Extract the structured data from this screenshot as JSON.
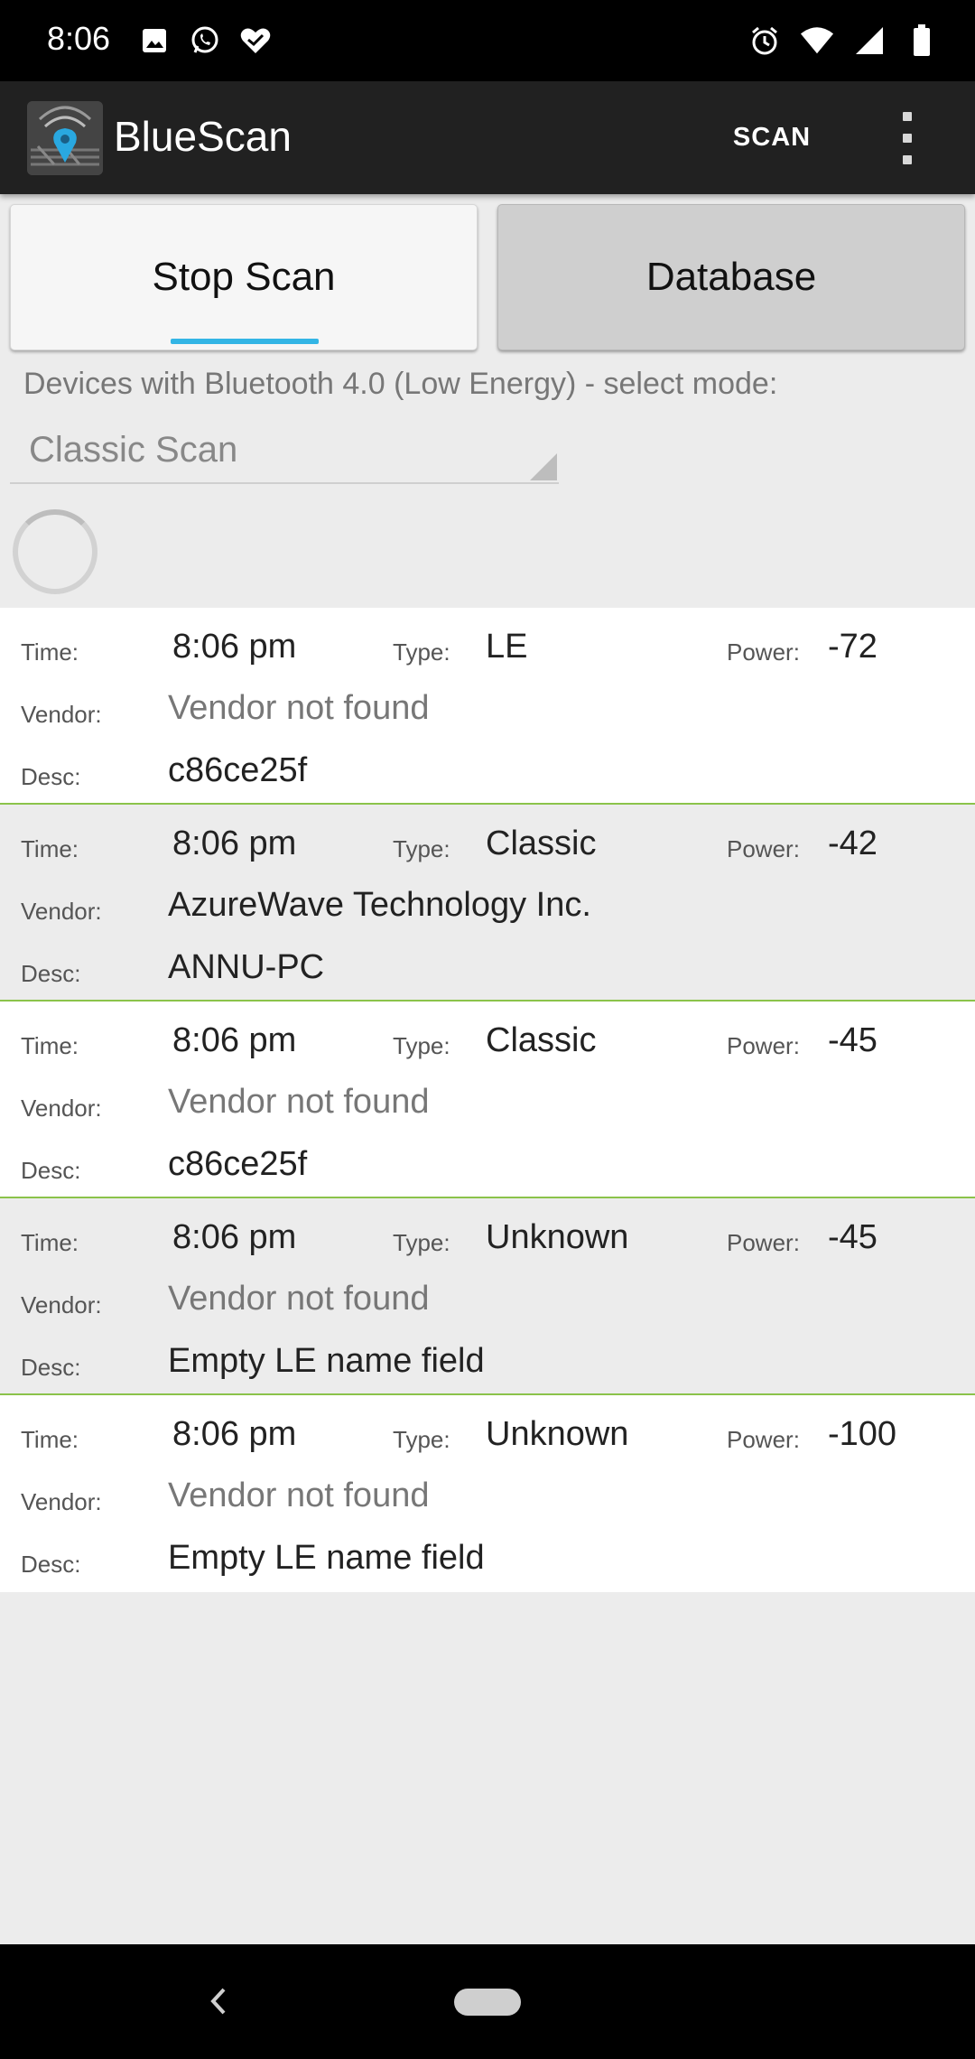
{
  "status_bar": {
    "time": "8:06",
    "left_icons": [
      "image-icon",
      "whatsapp-icon",
      "heart-check-icon"
    ],
    "right_icons": [
      "alarm-icon",
      "wifi-icon",
      "signal-icon",
      "battery-icon"
    ]
  },
  "app_bar": {
    "title": "BlueScan",
    "scan_action": "SCAN"
  },
  "buttons": {
    "stop_scan": "Stop Scan",
    "database": "Database"
  },
  "mode_label": "Devices with Bluetooth 4.0 (Low Energy) - select mode:",
  "mode_select": {
    "value": "Classic Scan"
  },
  "labels": {
    "time": "Time:",
    "type": "Type:",
    "power": "Power:",
    "vendor": "Vendor:",
    "desc": "Desc:"
  },
  "devices": [
    {
      "time": "8:06 pm",
      "type": "LE",
      "power": "-72",
      "vendor": "Vendor not found",
      "desc": "c86ce25f"
    },
    {
      "time": "8:06 pm",
      "type": "Classic",
      "power": "-42",
      "vendor": "AzureWave Technology Inc.",
      "desc": "ANNU-PC"
    },
    {
      "time": "8:06 pm",
      "type": "Classic",
      "power": "-45",
      "vendor": "Vendor not found",
      "desc": "c86ce25f"
    },
    {
      "time": "8:06 pm",
      "type": "Unknown",
      "power": "-45",
      "vendor": "Vendor not found",
      "desc": "Empty LE name field"
    },
    {
      "time": "8:06 pm",
      "type": "Unknown",
      "power": "-100",
      "vendor": "Vendor not found",
      "desc": "Empty LE name field"
    }
  ],
  "colors": {
    "accent": "#33b5e5",
    "divider": "#8bc34a",
    "app_bar": "#212121"
  }
}
